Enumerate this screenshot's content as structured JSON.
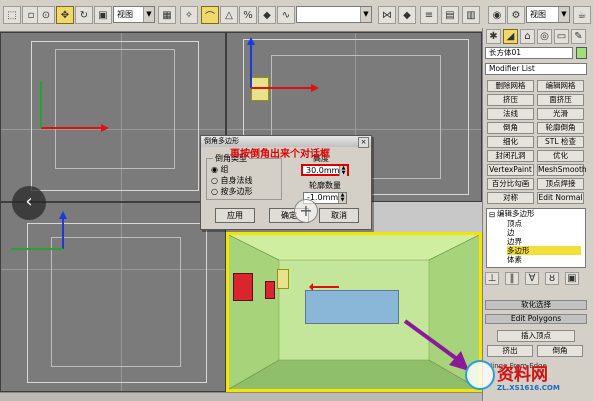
{
  "toolbar": {
    "view_dropdown_1": "视图",
    "view_dropdown_2": "视图"
  },
  "viewports": {
    "top_left": {
      "label": ""
    },
    "top_right": {
      "label": ""
    },
    "bottom_left": {
      "label": ""
    },
    "perspective": {
      "label": ""
    }
  },
  "dialog": {
    "title": "倒角多边形",
    "close": "×",
    "bevel_type_group": "倒角类型",
    "options": [
      "组",
      "自身法线",
      "按多边形"
    ],
    "height_label": "高度",
    "height_value": "30.0mm",
    "outline_label": "轮廓数量",
    "outline_value": "-1.0mm",
    "apply": "应用",
    "ok": "确定",
    "cancel": "取消"
  },
  "annotation": "再按倒角出来个对话框",
  "panel": {
    "object_name": "长方体01",
    "modifier_list": "Modifier List",
    "buttons": [
      [
        "删除网格",
        "编辑网格"
      ],
      [
        "挤压",
        "面挤压"
      ],
      [
        "法线",
        "光滑"
      ],
      [
        "倒角",
        "轮廓倒角"
      ],
      [
        "细化",
        "STL 检查"
      ],
      [
        "封闭孔洞",
        "优化"
      ],
      [
        "VertexPaint",
        "MeshSmooth"
      ],
      [
        "百分比勾画",
        "顶点焊接"
      ],
      [
        "对称",
        "Edit Normal"
      ]
    ],
    "stack_top": "编辑多边形",
    "stack_items": [
      "顶点",
      "边",
      "边界",
      "多边形",
      "体素"
    ],
    "rollouts": [
      "软化选择",
      "Edit Polygons"
    ],
    "insert_vertex": "插入顶点",
    "extrude": "挤出",
    "bevel": "倒角",
    "bottom_label": "Hinge From Edge"
  },
  "watermark": {
    "brand": "资料网",
    "url": "ZL.XS1616.COM"
  },
  "colors": {
    "annotation": "#e00000",
    "selected_stack": "#f3df38",
    "room_wall": "#b9e08a",
    "room_floor": "#8fbf6a",
    "selection_frame": "#f5e300",
    "purple_arrow": "#8a1a9a"
  }
}
